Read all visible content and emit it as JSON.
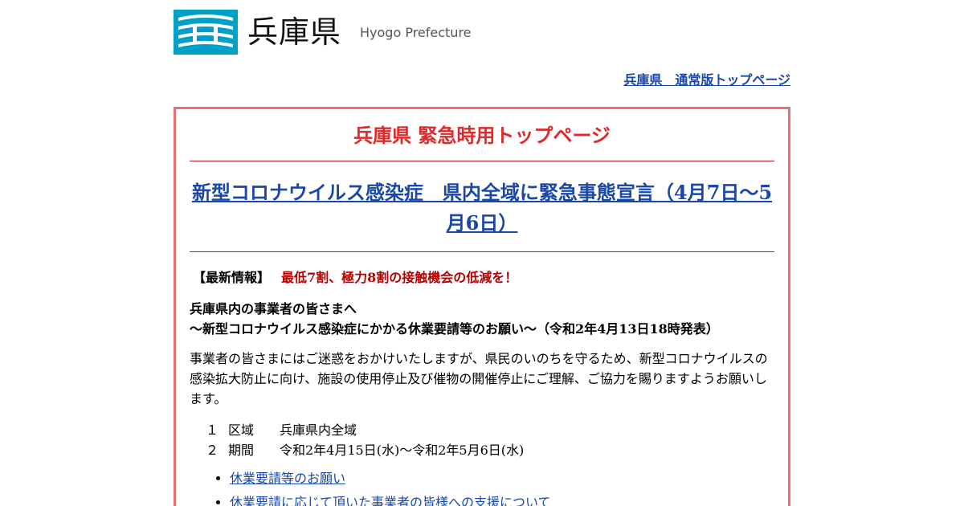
{
  "header": {
    "logo_jp": "兵庫県",
    "logo_en": "Hyogo Prefecture",
    "logo_icon": "hyogo-emblem-icon",
    "logo_color": "#00a0c8"
  },
  "normal_link": "兵庫県　通常版トップページ",
  "emergency": {
    "title": "兵庫県 緊急時用トップページ",
    "headline": "新型コロナウイルス感染症　県内全域に緊急事態宣言（4月7日～5月6日）",
    "latest_tag": "【最新情報】",
    "latest_msg": "最低7割、極力8割の接触機会の低減を！",
    "subhead_line1": "兵庫県内の事業者の皆さまへ",
    "subhead_line2": "～新型コロナウイルス感染症にかかる休業要請等のお願い～（令和2年4月13日18時発表）",
    "body": "事業者の皆さまにはご迷惑をおかけいたしますが、県民のいのちを守るため、新型コロナウイルスの感染拡大防止に向け、施設の使用停止及び催物の開催停止にご理解、ご協力を賜りますようお願いします。",
    "items": [
      {
        "num": "１",
        "key": "区域",
        "value": "兵庫県内全域"
      },
      {
        "num": "２",
        "key": "期間",
        "value": "令和2年4月15日(水)～令和2年5月6日(水)"
      }
    ],
    "links": [
      "休業要請等のお願い",
      "休業要請に応じて頂いた事業者の皆様への支援について"
    ],
    "title_color": "#dd2a2a",
    "border_color": "#e57373",
    "link_color": "#1a47a8"
  }
}
